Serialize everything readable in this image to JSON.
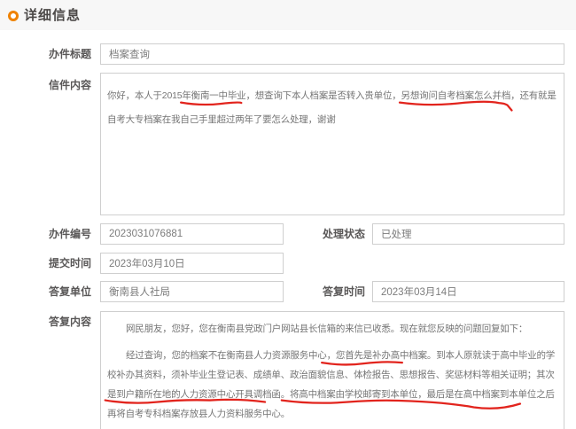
{
  "header": {
    "title": "详细信息"
  },
  "form": {
    "title": {
      "label": "办件标题",
      "value": "档案查询"
    },
    "letter": {
      "label": "信件内容",
      "value": "你好，本人于2015年衡南一中毕业，想查询下本人档案是否转入贵单位，另想询问自考档案怎么并档，还有就是自考大专档案在我自己手里超过两年了要怎么处理，谢谢"
    },
    "number": {
      "label": "办件编号",
      "value": "2023031076881"
    },
    "status": {
      "label": "处理状态",
      "value": "已处理"
    },
    "submit_time": {
      "label": "提交时间",
      "value": "2023年03月10日"
    },
    "reply_unit": {
      "label": "答复单位",
      "value": "衡南县人社局"
    },
    "reply_time": {
      "label": "答复时间",
      "value": "2023年03月14日"
    },
    "reply": {
      "label": "答复内容",
      "paragraphs": [
        "网民朋友，您好，您在衡南县党政门户网站县长信箱的来信已收悉。现在就您反映的问题回复如下：",
        "经过查询，您的档案不在衡南县人力资源服务中心，您首先是补办高中档案。到本人原就读于高中毕业的学校补办其资料，须补毕业生登记表、成绩单、政治面貌信息、体检报告、思想报告、奖惩材料等相关证明；其次是到户籍所在地的人力资源中心开具调档函。将高中档案由学校邮寄到本单位，最后是在高中档案到本单位之后再将自考专科档案存放县人力资料服务中心。"
      ]
    }
  },
  "annotations": {
    "underline_color": "#e2241d",
    "underlined_phrases": [
      "年衡南一中",
      "自考档案怎么并档，还",
      "您首先是补办高中档案",
      "到户籍所在地的人力资源中心开具调档函",
      "将高中档案由学校邮寄到本单位，最后是在高中档案到本单位之后再将"
    ]
  }
}
